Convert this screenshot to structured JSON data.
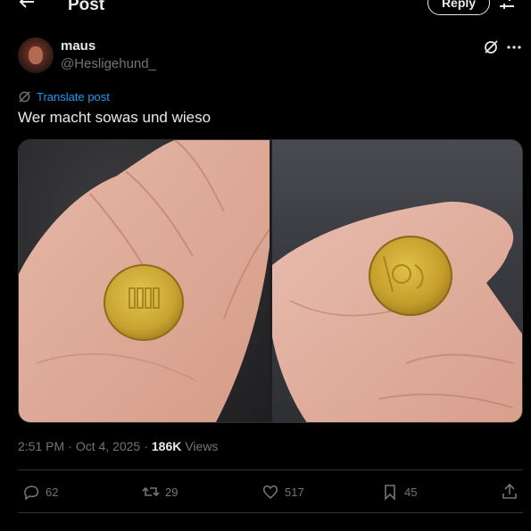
{
  "header": {
    "title": "Post",
    "reply_label": "Reply"
  },
  "author": {
    "display_name": "maus",
    "handle": "@Hesligehund_"
  },
  "post": {
    "translate_label": "Translate post",
    "text": "Wer macht sowas und wieso"
  },
  "meta": {
    "time": "2:51 PM",
    "sep1": "·",
    "date": "Oct 4, 2025",
    "sep2": "·",
    "views_count": "186K",
    "views_label": "Views"
  },
  "actions": {
    "replies": "62",
    "reposts": "29",
    "likes": "517",
    "bookmarks": "45"
  },
  "colors": {
    "accent": "#1d9bf0",
    "muted": "#71767b",
    "text": "#e7e9ea",
    "border": "#2f3336"
  }
}
